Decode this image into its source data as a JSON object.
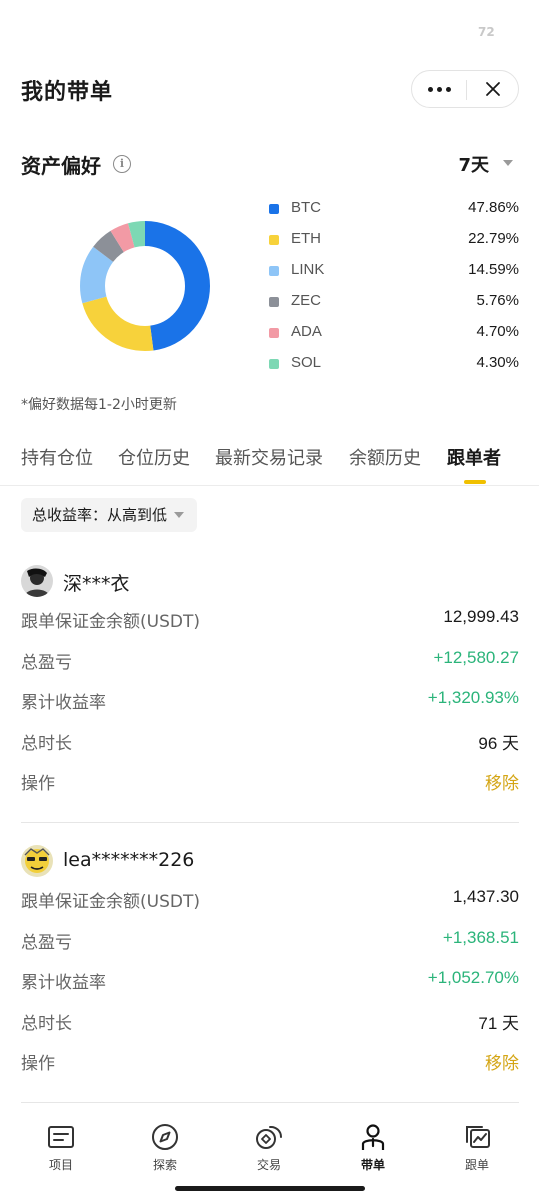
{
  "status": {
    "indicator": "72"
  },
  "header": {
    "title": "我的带单"
  },
  "preference": {
    "title": "资产偏好",
    "period": "7天",
    "note": "*偏好数据每1-2小时更新"
  },
  "chart_data": {
    "type": "pie",
    "categories": [
      "BTC",
      "ETH",
      "LINK",
      "ZEC",
      "ADA",
      "SOL"
    ],
    "values": [
      47.86,
      22.79,
      14.59,
      5.76,
      4.7,
      4.3
    ],
    "labels": [
      "47.86%",
      "22.79%",
      "14.59%",
      "5.76%",
      "4.70%",
      "4.30%"
    ],
    "colors": [
      "#1a73e8",
      "#f7d23b",
      "#8ec5f7",
      "#8c9098",
      "#f29aa5",
      "#7dd8b4"
    ]
  },
  "tabs": [
    "持有仓位",
    "仓位历史",
    "最新交易记录",
    "余额历史",
    "跟单者"
  ],
  "sort": {
    "label": "总收益率：从高到低"
  },
  "followers": [
    {
      "name": "深***衣",
      "rows": [
        {
          "label": "跟单保证金余额(USDT)",
          "value": "12,999.43"
        },
        {
          "label": "总盈亏",
          "value": "+12,580.27"
        },
        {
          "label": "累计收益率",
          "value": "+1,320.93%"
        },
        {
          "label": "总时长",
          "value": "96 天"
        },
        {
          "label": "操作",
          "value": "移除"
        }
      ]
    },
    {
      "name": "lea*******226",
      "rows": [
        {
          "label": "跟单保证金余额(USDT)",
          "value": "1,437.30"
        },
        {
          "label": "总盈亏",
          "value": "+1,368.51"
        },
        {
          "label": "累计收益率",
          "value": "+1,052.70%"
        },
        {
          "label": "总时长",
          "value": "71 天"
        },
        {
          "label": "操作",
          "value": "移除"
        }
      ]
    }
  ],
  "tabbar": [
    "项目",
    "探索",
    "交易",
    "带单",
    "跟单"
  ],
  "colors": {
    "positive": "#2bb47a",
    "action": "#d4a514",
    "accent": "#f0c000"
  }
}
